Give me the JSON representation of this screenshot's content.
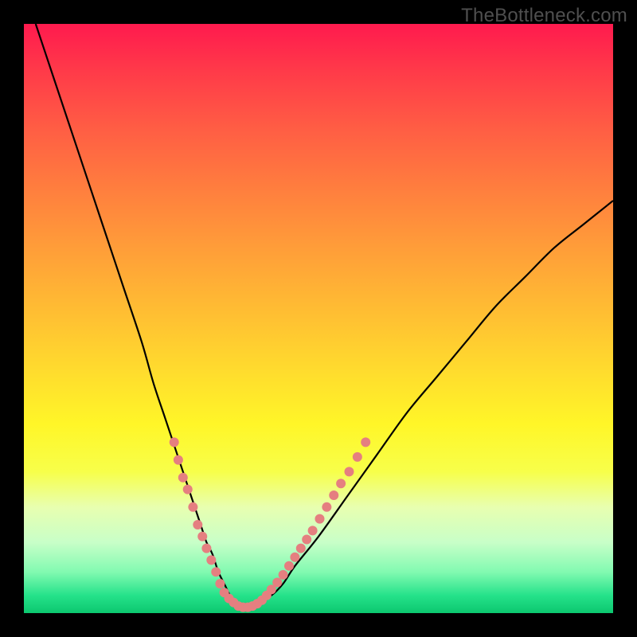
{
  "watermark": {
    "text": "TheBottleneck.com"
  },
  "colors": {
    "frame": "#000000",
    "curve": "#000000",
    "marker": "#e57f80",
    "gradient_top": "#ff1a4e",
    "gradient_bottom": "#0cc76f"
  },
  "chart_data": {
    "type": "line",
    "title": "",
    "xlabel": "",
    "ylabel": "",
    "xlim": [
      0,
      100
    ],
    "ylim": [
      0,
      100
    ],
    "grid": false,
    "series": [
      {
        "name": "bottleneck-curve",
        "x": [
          2,
          5,
          8,
          11,
          14,
          17,
          20,
          22,
          24,
          26,
          28,
          30,
          31,
          32,
          33,
          34,
          35,
          36,
          37,
          38,
          39,
          40,
          42,
          44,
          46,
          50,
          55,
          60,
          65,
          70,
          75,
          80,
          85,
          90,
          95,
          100
        ],
        "y": [
          100,
          91,
          82,
          73,
          64,
          55,
          46,
          39,
          33,
          27,
          21,
          15,
          12,
          10,
          7,
          5,
          3,
          2,
          1,
          1,
          1,
          2,
          3,
          5,
          8,
          13,
          20,
          27,
          34,
          40,
          46,
          52,
          57,
          62,
          66,
          70
        ]
      }
    ],
    "markers": {
      "name": "highlight-dots",
      "color": "#e57f80",
      "radius_px": 6,
      "points": [
        {
          "x": 25.5,
          "y": 29
        },
        {
          "x": 26.2,
          "y": 26
        },
        {
          "x": 27.0,
          "y": 23
        },
        {
          "x": 27.8,
          "y": 21
        },
        {
          "x": 28.7,
          "y": 18
        },
        {
          "x": 29.5,
          "y": 15
        },
        {
          "x": 30.3,
          "y": 13
        },
        {
          "x": 31.0,
          "y": 11
        },
        {
          "x": 31.8,
          "y": 9
        },
        {
          "x": 32.6,
          "y": 7
        },
        {
          "x": 33.3,
          "y": 5
        },
        {
          "x": 34.0,
          "y": 3.5
        },
        {
          "x": 34.8,
          "y": 2.5
        },
        {
          "x": 35.6,
          "y": 1.8
        },
        {
          "x": 36.4,
          "y": 1.2
        },
        {
          "x": 37.2,
          "y": 1.0
        },
        {
          "x": 38.0,
          "y": 1.0
        },
        {
          "x": 38.8,
          "y": 1.2
        },
        {
          "x": 39.6,
          "y": 1.6
        },
        {
          "x": 40.4,
          "y": 2.2
        },
        {
          "x": 41.2,
          "y": 3.0
        },
        {
          "x": 42.0,
          "y": 4.0
        },
        {
          "x": 43.0,
          "y": 5.2
        },
        {
          "x": 44.0,
          "y": 6.5
        },
        {
          "x": 45.0,
          "y": 8.0
        },
        {
          "x": 46.0,
          "y": 9.5
        },
        {
          "x": 47.0,
          "y": 11.0
        },
        {
          "x": 48.0,
          "y": 12.5
        },
        {
          "x": 49.0,
          "y": 14.0
        },
        {
          "x": 50.2,
          "y": 16.0
        },
        {
          "x": 51.4,
          "y": 18.0
        },
        {
          "x": 52.6,
          "y": 20.0
        },
        {
          "x": 53.8,
          "y": 22.0
        },
        {
          "x": 55.2,
          "y": 24.0
        },
        {
          "x": 56.6,
          "y": 26.5
        },
        {
          "x": 58.0,
          "y": 29.0
        }
      ]
    }
  }
}
